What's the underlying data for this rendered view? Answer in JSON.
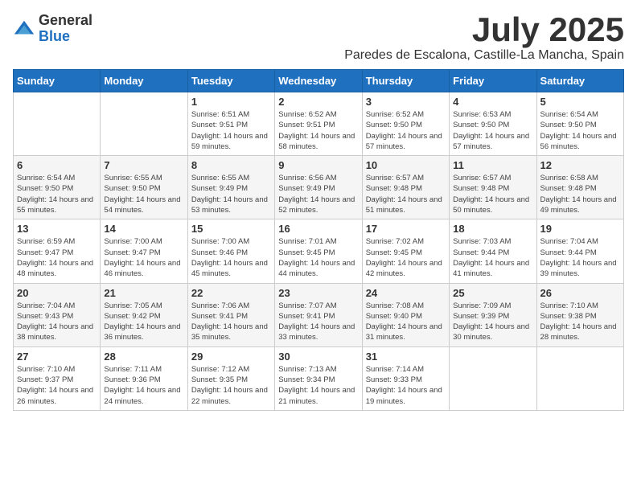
{
  "logo": {
    "general": "General",
    "blue": "Blue"
  },
  "title": "July 2025",
  "location": "Paredes de Escalona, Castille-La Mancha, Spain",
  "days_of_week": [
    "Sunday",
    "Monday",
    "Tuesday",
    "Wednesday",
    "Thursday",
    "Friday",
    "Saturday"
  ],
  "weeks": [
    [
      {
        "day": "",
        "sunrise": "",
        "sunset": "",
        "daylight": ""
      },
      {
        "day": "",
        "sunrise": "",
        "sunset": "",
        "daylight": ""
      },
      {
        "day": "1",
        "sunrise": "Sunrise: 6:51 AM",
        "sunset": "Sunset: 9:51 PM",
        "daylight": "Daylight: 14 hours and 59 minutes."
      },
      {
        "day": "2",
        "sunrise": "Sunrise: 6:52 AM",
        "sunset": "Sunset: 9:51 PM",
        "daylight": "Daylight: 14 hours and 58 minutes."
      },
      {
        "day": "3",
        "sunrise": "Sunrise: 6:52 AM",
        "sunset": "Sunset: 9:50 PM",
        "daylight": "Daylight: 14 hours and 57 minutes."
      },
      {
        "day": "4",
        "sunrise": "Sunrise: 6:53 AM",
        "sunset": "Sunset: 9:50 PM",
        "daylight": "Daylight: 14 hours and 57 minutes."
      },
      {
        "day": "5",
        "sunrise": "Sunrise: 6:54 AM",
        "sunset": "Sunset: 9:50 PM",
        "daylight": "Daylight: 14 hours and 56 minutes."
      }
    ],
    [
      {
        "day": "6",
        "sunrise": "Sunrise: 6:54 AM",
        "sunset": "Sunset: 9:50 PM",
        "daylight": "Daylight: 14 hours and 55 minutes."
      },
      {
        "day": "7",
        "sunrise": "Sunrise: 6:55 AM",
        "sunset": "Sunset: 9:50 PM",
        "daylight": "Daylight: 14 hours and 54 minutes."
      },
      {
        "day": "8",
        "sunrise": "Sunrise: 6:55 AM",
        "sunset": "Sunset: 9:49 PM",
        "daylight": "Daylight: 14 hours and 53 minutes."
      },
      {
        "day": "9",
        "sunrise": "Sunrise: 6:56 AM",
        "sunset": "Sunset: 9:49 PM",
        "daylight": "Daylight: 14 hours and 52 minutes."
      },
      {
        "day": "10",
        "sunrise": "Sunrise: 6:57 AM",
        "sunset": "Sunset: 9:48 PM",
        "daylight": "Daylight: 14 hours and 51 minutes."
      },
      {
        "day": "11",
        "sunrise": "Sunrise: 6:57 AM",
        "sunset": "Sunset: 9:48 PM",
        "daylight": "Daylight: 14 hours and 50 minutes."
      },
      {
        "day": "12",
        "sunrise": "Sunrise: 6:58 AM",
        "sunset": "Sunset: 9:48 PM",
        "daylight": "Daylight: 14 hours and 49 minutes."
      }
    ],
    [
      {
        "day": "13",
        "sunrise": "Sunrise: 6:59 AM",
        "sunset": "Sunset: 9:47 PM",
        "daylight": "Daylight: 14 hours and 48 minutes."
      },
      {
        "day": "14",
        "sunrise": "Sunrise: 7:00 AM",
        "sunset": "Sunset: 9:47 PM",
        "daylight": "Daylight: 14 hours and 46 minutes."
      },
      {
        "day": "15",
        "sunrise": "Sunrise: 7:00 AM",
        "sunset": "Sunset: 9:46 PM",
        "daylight": "Daylight: 14 hours and 45 minutes."
      },
      {
        "day": "16",
        "sunrise": "Sunrise: 7:01 AM",
        "sunset": "Sunset: 9:45 PM",
        "daylight": "Daylight: 14 hours and 44 minutes."
      },
      {
        "day": "17",
        "sunrise": "Sunrise: 7:02 AM",
        "sunset": "Sunset: 9:45 PM",
        "daylight": "Daylight: 14 hours and 42 minutes."
      },
      {
        "day": "18",
        "sunrise": "Sunrise: 7:03 AM",
        "sunset": "Sunset: 9:44 PM",
        "daylight": "Daylight: 14 hours and 41 minutes."
      },
      {
        "day": "19",
        "sunrise": "Sunrise: 7:04 AM",
        "sunset": "Sunset: 9:44 PM",
        "daylight": "Daylight: 14 hours and 39 minutes."
      }
    ],
    [
      {
        "day": "20",
        "sunrise": "Sunrise: 7:04 AM",
        "sunset": "Sunset: 9:43 PM",
        "daylight": "Daylight: 14 hours and 38 minutes."
      },
      {
        "day": "21",
        "sunrise": "Sunrise: 7:05 AM",
        "sunset": "Sunset: 9:42 PM",
        "daylight": "Daylight: 14 hours and 36 minutes."
      },
      {
        "day": "22",
        "sunrise": "Sunrise: 7:06 AM",
        "sunset": "Sunset: 9:41 PM",
        "daylight": "Daylight: 14 hours and 35 minutes."
      },
      {
        "day": "23",
        "sunrise": "Sunrise: 7:07 AM",
        "sunset": "Sunset: 9:41 PM",
        "daylight": "Daylight: 14 hours and 33 minutes."
      },
      {
        "day": "24",
        "sunrise": "Sunrise: 7:08 AM",
        "sunset": "Sunset: 9:40 PM",
        "daylight": "Daylight: 14 hours and 31 minutes."
      },
      {
        "day": "25",
        "sunrise": "Sunrise: 7:09 AM",
        "sunset": "Sunset: 9:39 PM",
        "daylight": "Daylight: 14 hours and 30 minutes."
      },
      {
        "day": "26",
        "sunrise": "Sunrise: 7:10 AM",
        "sunset": "Sunset: 9:38 PM",
        "daylight": "Daylight: 14 hours and 28 minutes."
      }
    ],
    [
      {
        "day": "27",
        "sunrise": "Sunrise: 7:10 AM",
        "sunset": "Sunset: 9:37 PM",
        "daylight": "Daylight: 14 hours and 26 minutes."
      },
      {
        "day": "28",
        "sunrise": "Sunrise: 7:11 AM",
        "sunset": "Sunset: 9:36 PM",
        "daylight": "Daylight: 14 hours and 24 minutes."
      },
      {
        "day": "29",
        "sunrise": "Sunrise: 7:12 AM",
        "sunset": "Sunset: 9:35 PM",
        "daylight": "Daylight: 14 hours and 22 minutes."
      },
      {
        "day": "30",
        "sunrise": "Sunrise: 7:13 AM",
        "sunset": "Sunset: 9:34 PM",
        "daylight": "Daylight: 14 hours and 21 minutes."
      },
      {
        "day": "31",
        "sunrise": "Sunrise: 7:14 AM",
        "sunset": "Sunset: 9:33 PM",
        "daylight": "Daylight: 14 hours and 19 minutes."
      },
      {
        "day": "",
        "sunrise": "",
        "sunset": "",
        "daylight": ""
      },
      {
        "day": "",
        "sunrise": "",
        "sunset": "",
        "daylight": ""
      }
    ]
  ]
}
